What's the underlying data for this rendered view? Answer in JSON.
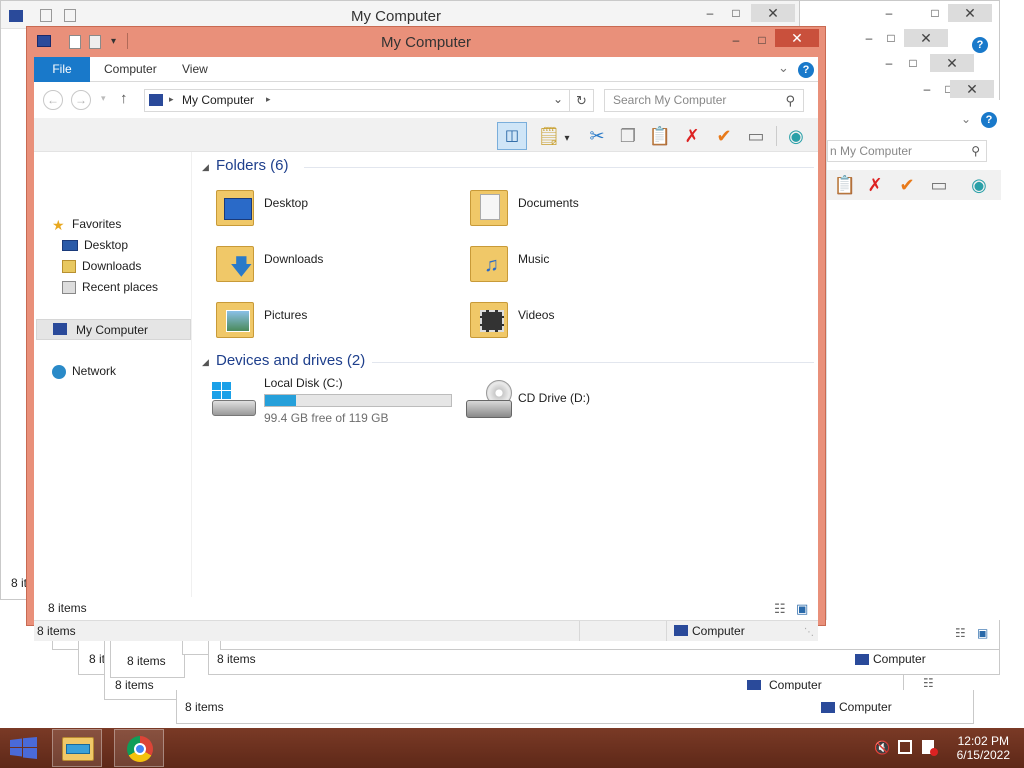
{
  "window": {
    "title": "My Computer",
    "minimize": "–",
    "maximize": "□",
    "close": "✕"
  },
  "ribbon": {
    "tabs": [
      "File",
      "Computer",
      "View"
    ]
  },
  "address": {
    "path": "My Computer",
    "search_placeholder": "Search My Computer"
  },
  "nav": {
    "favorites_label": "Favorites",
    "favorites": [
      "Desktop",
      "Downloads",
      "Recent places"
    ],
    "computer_label": "My Computer",
    "network_label": "Network"
  },
  "folders": {
    "header": "Folders (6)",
    "items": [
      "Desktop",
      "Documents",
      "Downloads",
      "Music",
      "Pictures",
      "Videos"
    ]
  },
  "drives": {
    "header": "Devices and drives (2)",
    "local": {
      "name": "Local Disk (C:)",
      "free": "99.4 GB free of 119 GB",
      "used_fraction": 0.165
    },
    "cd": {
      "name": "CD Drive (D:)"
    }
  },
  "status": {
    "items": "8 items",
    "computer": "Computer"
  },
  "background_windows": {
    "title": "My Computer",
    "search_partial": "n My Computer",
    "items_partial": "8 it",
    "items": "8 items",
    "computer": "Computer"
  },
  "taskbar": {
    "time": "12:02 PM",
    "date": "6/15/2022"
  },
  "colors": {
    "accent": "#1979ca",
    "window_frame": "#e9907a",
    "taskbar": "#6b301d",
    "group_header": "#1e3f8c",
    "drive_bar": "#26a0da"
  }
}
